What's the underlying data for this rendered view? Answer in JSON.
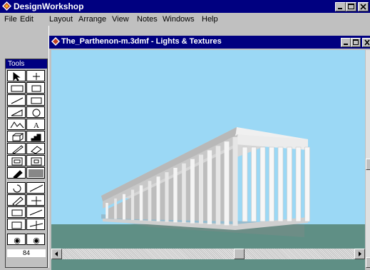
{
  "app": {
    "title": "DesignWorkshop"
  },
  "menu": [
    "File",
    "Edit",
    "Layout",
    "Arrange",
    "View",
    "Notes",
    "Windows",
    "Help"
  ],
  "document": {
    "title": "The_Parthenon-m.3dmf - Lights & Textures"
  },
  "tools": {
    "title": "Tools",
    "zoom_value": "84"
  },
  "colors": {
    "titlebar": "#000080",
    "sky": "#9bd8f5",
    "ground": "#5f8f85",
    "chrome": "#c0c0c0"
  }
}
